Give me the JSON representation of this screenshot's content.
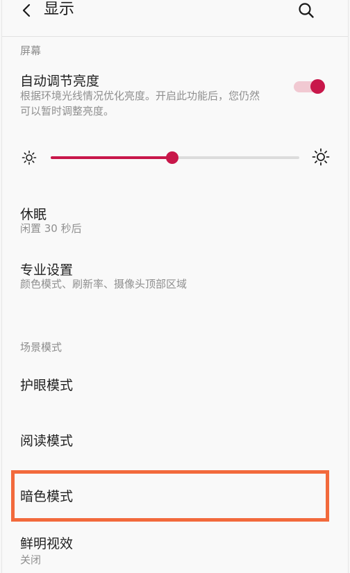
{
  "header": {
    "title": "显示",
    "back_icon": "chevron-left-icon",
    "search_icon": "search-icon"
  },
  "sections": {
    "screen_label": "屏幕",
    "scene_label": "场景模式"
  },
  "auto_brightness": {
    "title": "自动调节亮度",
    "desc_line1": "根据环境光线情况优化亮度。开启此功能后，您仍然",
    "desc_line2": "可以暂时调整亮度。",
    "enabled": true
  },
  "brightness": {
    "value_percent": 49
  },
  "sleep": {
    "title": "休眠",
    "sub": "闲置 30 秒后"
  },
  "pro_settings": {
    "title": "专业设置",
    "sub": "颜色模式、刷新率、摄像头顶部区域"
  },
  "modes": {
    "eye_care": "护眼模式",
    "reading": "阅读模式",
    "dark": "暗色模式",
    "vivid": "鲜明视效",
    "vivid_sub": "关闭"
  },
  "colors": {
    "accent": "#c8174a",
    "accent_light": "#f1c9d2",
    "highlight": "#f26a3c"
  }
}
